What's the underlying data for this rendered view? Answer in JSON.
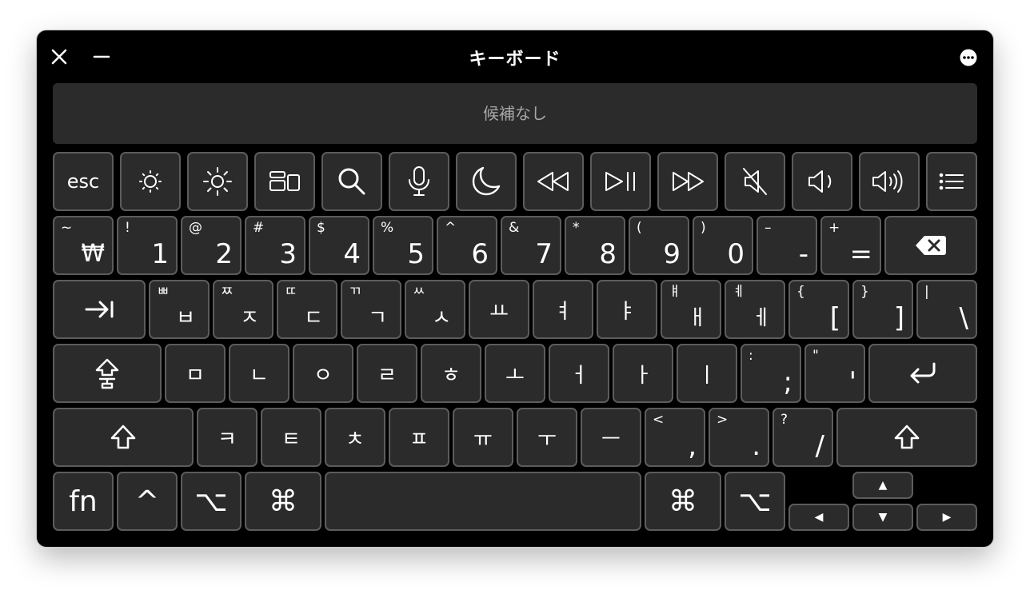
{
  "window": {
    "title": "キーボード"
  },
  "candidate_bar": {
    "text": "候補なし"
  },
  "function_row": {
    "esc": "esc",
    "icons": [
      "brightness-down-icon",
      "brightness-up-icon",
      "mission-control-icon",
      "search-icon",
      "microphone-icon",
      "moon-icon",
      "rewind-icon",
      "play-pause-icon",
      "fast-forward-icon",
      "mute-icon",
      "volume-down-icon",
      "volume-up-icon",
      "list-icon"
    ]
  },
  "number_row": {
    "keys": [
      {
        "shift": "~",
        "main": "₩"
      },
      {
        "shift": "!",
        "main": "1"
      },
      {
        "shift": "@",
        "main": "2"
      },
      {
        "shift": "#",
        "main": "3"
      },
      {
        "shift": "$",
        "main": "4"
      },
      {
        "shift": "%",
        "main": "5"
      },
      {
        "shift": "^",
        "main": "6"
      },
      {
        "shift": "&",
        "main": "7"
      },
      {
        "shift": "*",
        "main": "8"
      },
      {
        "shift": "(",
        "main": "9"
      },
      {
        "shift": ")",
        "main": "0"
      },
      {
        "shift": "–",
        "main": "-"
      },
      {
        "shift": "+",
        "main": "="
      }
    ],
    "delete_icon": "delete-icon"
  },
  "tab_row": {
    "tab_icon": "tab-icon",
    "keys": [
      {
        "shift": "ㅃ",
        "main": "ㅂ"
      },
      {
        "shift": "ㅉ",
        "main": "ㅈ"
      },
      {
        "shift": "ㄸ",
        "main": "ㄷ"
      },
      {
        "shift": "ㄲ",
        "main": "ㄱ"
      },
      {
        "shift": "ㅆ",
        "main": "ㅅ"
      },
      {
        "shift": "",
        "main": "ㅛ"
      },
      {
        "shift": "",
        "main": "ㅕ"
      },
      {
        "shift": "",
        "main": "ㅑ"
      },
      {
        "shift": "ㅒ",
        "main": "ㅐ"
      },
      {
        "shift": "ㅖ",
        "main": "ㅔ"
      },
      {
        "shift": "{",
        "main": "["
      },
      {
        "shift": "}",
        "main": "]"
      },
      {
        "shift": "|",
        "main": "\\"
      }
    ]
  },
  "home_row": {
    "caps_label": "caps-lock-hangul-icon",
    "keys": [
      {
        "shift": "",
        "main": "ㅁ"
      },
      {
        "shift": "",
        "main": "ㄴ"
      },
      {
        "shift": "",
        "main": "ㅇ"
      },
      {
        "shift": "",
        "main": "ㄹ"
      },
      {
        "shift": "",
        "main": "ㅎ"
      },
      {
        "shift": "",
        "main": "ㅗ"
      },
      {
        "shift": "",
        "main": "ㅓ"
      },
      {
        "shift": "",
        "main": "ㅏ"
      },
      {
        "shift": "",
        "main": "ㅣ"
      },
      {
        "shift": ":",
        "main": ";"
      },
      {
        "shift": "\"",
        "main": "'"
      }
    ],
    "return_icon": "return-icon"
  },
  "shift_row": {
    "shift_icon": "shift-icon",
    "keys": [
      {
        "shift": "",
        "main": "ㅋ"
      },
      {
        "shift": "",
        "main": "ㅌ"
      },
      {
        "shift": "",
        "main": "ㅊ"
      },
      {
        "shift": "",
        "main": "ㅍ"
      },
      {
        "shift": "",
        "main": "ㅠ"
      },
      {
        "shift": "",
        "main": "ㅜ"
      },
      {
        "shift": "",
        "main": "ㅡ"
      },
      {
        "shift": "<",
        "main": ","
      },
      {
        "shift": ">",
        "main": "."
      },
      {
        "shift": "?",
        "main": "/"
      }
    ]
  },
  "bottom_row": {
    "fn": "fn",
    "control": "^",
    "option": "⌥",
    "command": "⌘",
    "arrow_up": "▲",
    "arrow_left": "◀",
    "arrow_down": "▼",
    "arrow_right": "▶"
  }
}
